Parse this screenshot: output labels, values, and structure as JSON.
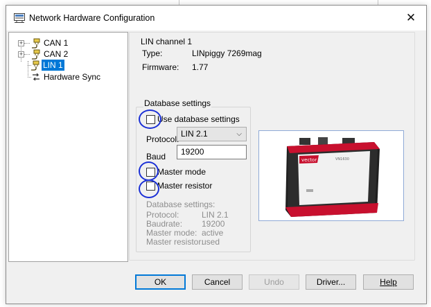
{
  "window": {
    "title": "Network Hardware Configuration",
    "close_glyph": "✕",
    "icon": "network-config-icon"
  },
  "tree": {
    "items": [
      {
        "label": "CAN 1",
        "icon": "channel-plug-icon",
        "expander": "+",
        "selected": false
      },
      {
        "label": "CAN 2",
        "icon": "channel-plug-icon",
        "expander": "+",
        "selected": false
      },
      {
        "label": "LIN 1",
        "icon": "channel-plug-icon",
        "expander": "",
        "selected": true
      },
      {
        "label": "Hardware Sync",
        "icon": "sync-icon",
        "expander": "",
        "selected": false
      }
    ]
  },
  "channel": {
    "heading": "LIN channel 1",
    "type_label": "Type:",
    "type_value": "LINpiggy 7269mag",
    "firmware_label": "Firmware:",
    "firmware_value": "1.77"
  },
  "database_group": {
    "title": "Database settings",
    "use_db_label": "Use database settings",
    "use_db_checked": false,
    "protocol_label": "Protocol:",
    "protocol_value": "LIN 2.1",
    "baud_label": "Baud",
    "baud_value": "19200",
    "master_mode_label": "Master mode",
    "master_mode_checked": false,
    "master_resistor_label": "Master resistor",
    "master_resistor_checked": false,
    "db_info": {
      "heading": "Database settings:",
      "protocol_label": "Protocol:",
      "protocol_value": "LIN 2.1",
      "baudrate_label": "Baudrate:",
      "baudrate_value": "19200",
      "master_mode_label": "Master mode:",
      "master_mode_value": "active",
      "master_resistor_label": "Master resistor:",
      "master_resistor_value": "used"
    }
  },
  "device_image": {
    "brand": "vector",
    "model": "VN1630"
  },
  "buttons": {
    "ok": "OK",
    "cancel": "Cancel",
    "undo": "Undo",
    "driver": "Driver...",
    "help": "Help"
  },
  "colors": {
    "accent": "#0078d7",
    "annotation": "#1a2fd6",
    "device_red": "#c8102e"
  }
}
